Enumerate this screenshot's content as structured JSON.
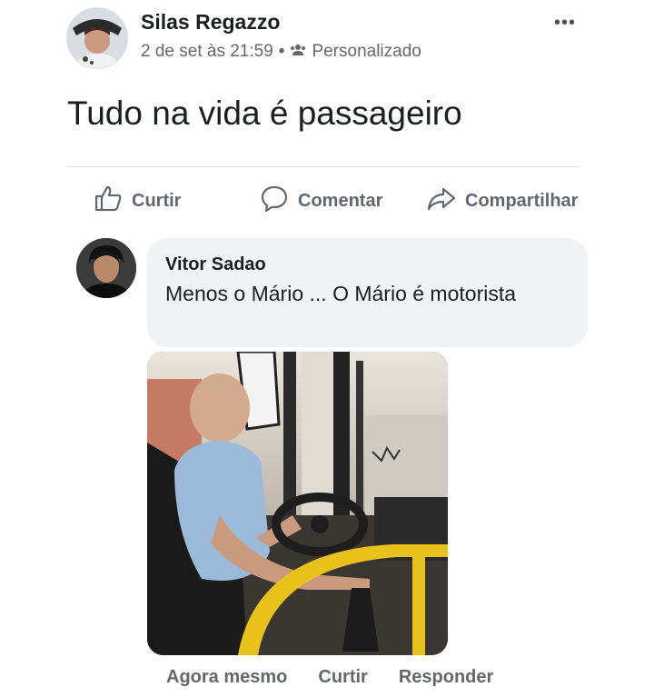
{
  "post": {
    "author": "Silas Regazzo",
    "date": "2 de set às 21:59",
    "separator": "•",
    "privacy": "Personalizado",
    "privacy_icon": "people-icon",
    "more": "•••",
    "text": "Tudo na vida é passageiro"
  },
  "actions": {
    "like_label": "Curtir",
    "comment_label": "Comentar",
    "share_label": "Compartilhar"
  },
  "comment": {
    "author": "Vitor Sadao",
    "text": "Menos o Mário ... O Mário é motorista",
    "footer": {
      "time": "Agora mesmo",
      "like_label": "Curtir",
      "reply_label": "Responder"
    }
  },
  "colors": {
    "text_primary": "#1c1e21",
    "text_secondary": "#65676b",
    "bubble": "#f0f2f5",
    "accent_yellow": "#e8c21a"
  }
}
